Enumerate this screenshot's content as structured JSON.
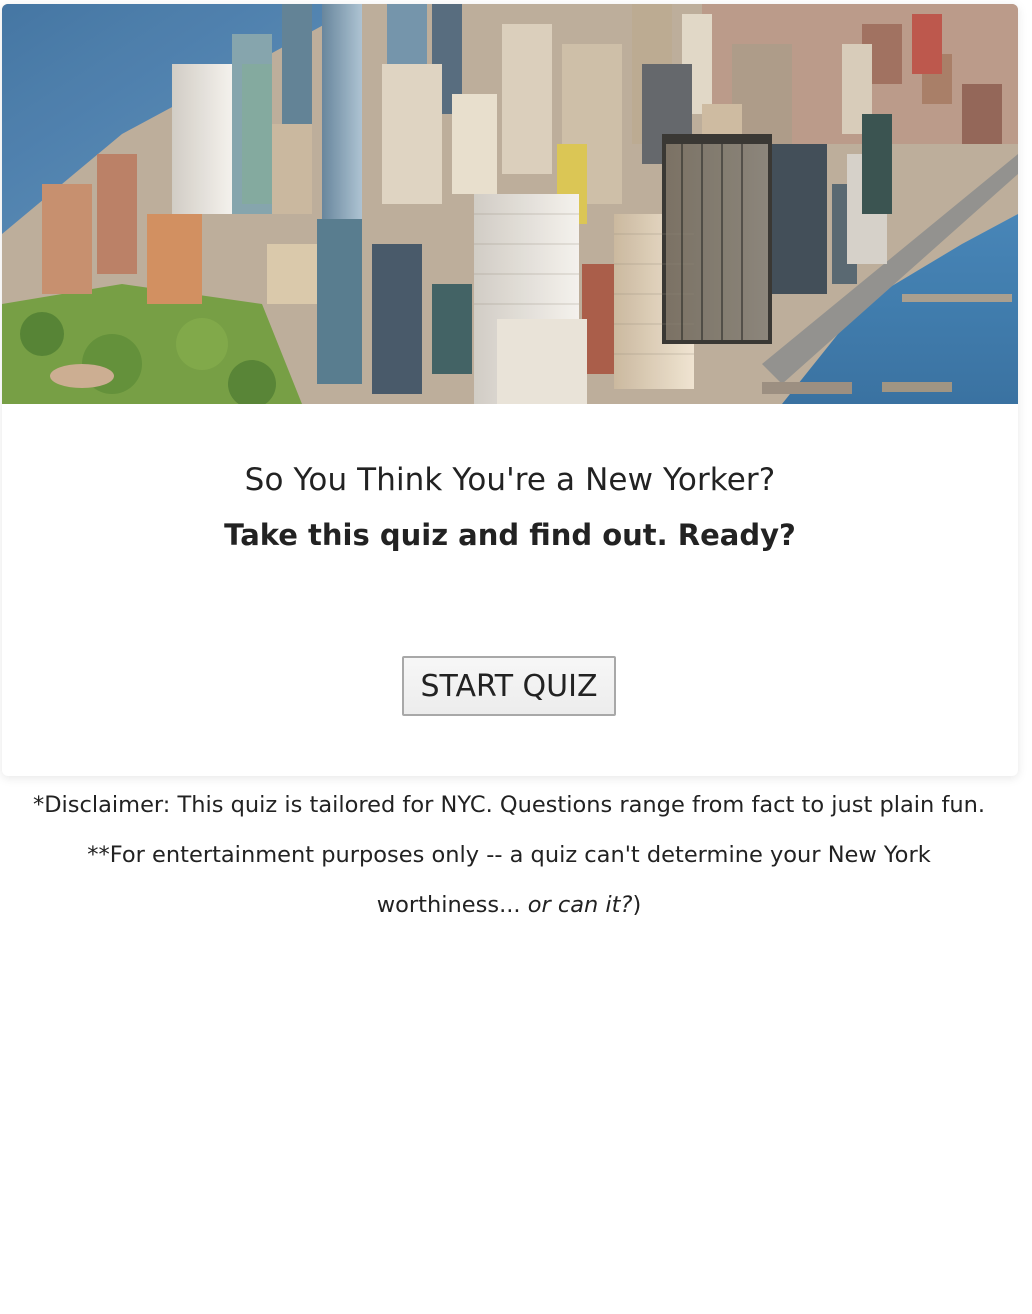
{
  "quiz": {
    "title": "So You Think You're a New Yorker?",
    "subtitle": "Take this quiz and find out. Ready?",
    "start_button": "START QUIZ"
  },
  "hero_image": {
    "subject": "aerial view of lower Manhattan skyline and waterfront"
  },
  "footer": {
    "disclaimer": "*Disclaimer: This quiz is tailored for NYC. Questions range from fact to just plain fun.",
    "entertainment_prefix": "**For entertainment purposes only -- a quiz can't determine your New York worthiness... ",
    "entertainment_italic": "or can it?",
    "entertainment_suffix": ")"
  },
  "colors": {
    "text": "#222222",
    "button_border": "#a8a8a8",
    "button_bg": "#f0f0f0",
    "water": "#3f7bb0"
  }
}
